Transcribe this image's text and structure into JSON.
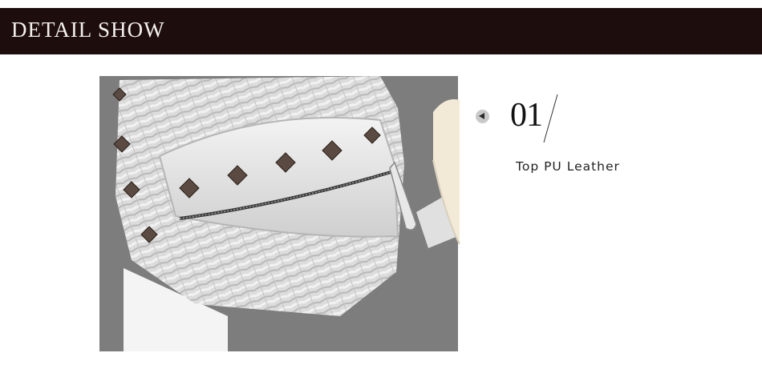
{
  "header": {
    "title": "DETAIL SHOW",
    "background_color": "#1e0d0d",
    "text_color": "#f4f1ee"
  },
  "detail": {
    "number": "01",
    "feature": "Top PU Leather",
    "bullet_icon": "left-arrow-circle-icon"
  },
  "image": {
    "description_icon": "silver-woven-backpack-photo"
  }
}
